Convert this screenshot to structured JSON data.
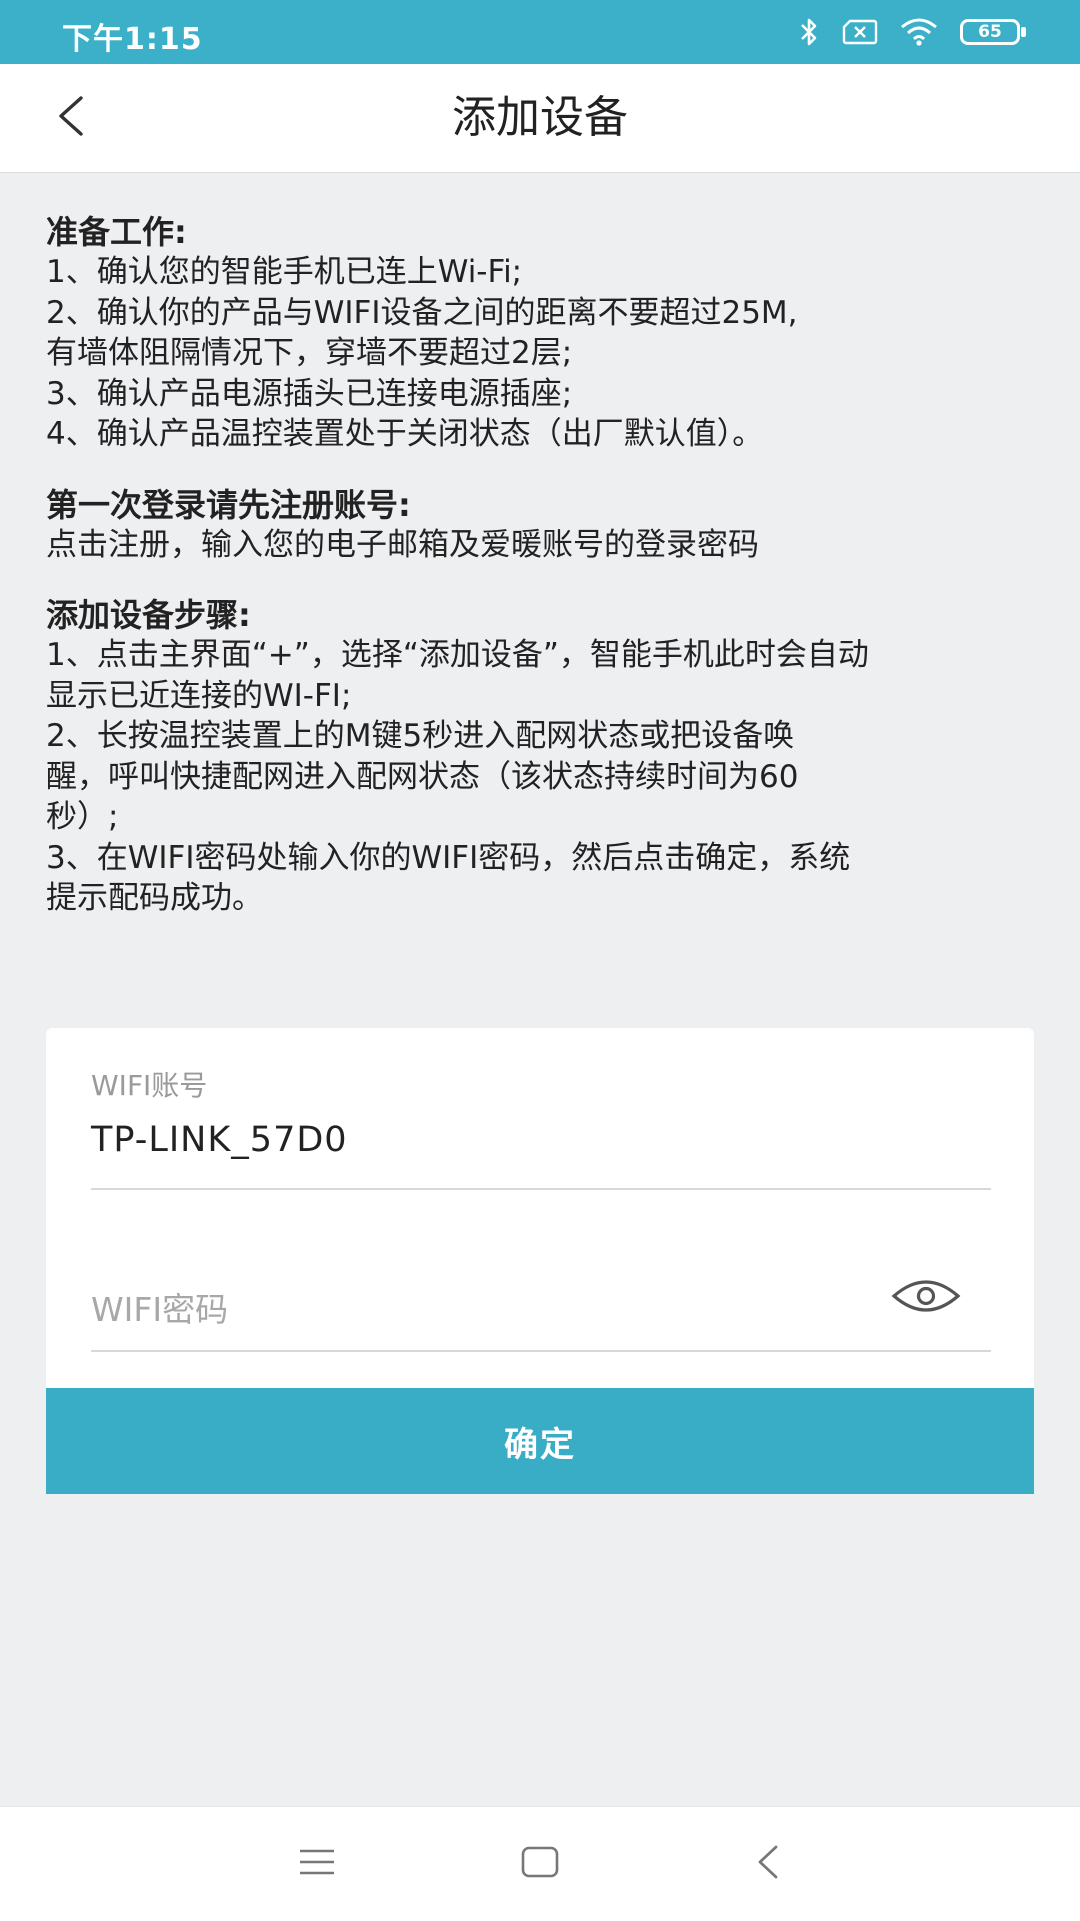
{
  "status_bar": {
    "time": "下午1:15",
    "battery": "65",
    "icons": [
      "bluetooth-icon",
      "no-sim-icon",
      "wifi-signal-icon",
      "battery-icon"
    ]
  },
  "header": {
    "title": "添加设备",
    "back_icon": "chevron-left-icon"
  },
  "instructions": {
    "prep_title": "准备工作:",
    "prep_lines": [
      "1、确认您的智能手机已连上Wi-Fi;",
      " 2、确认你的产品与WIFI设备之间的距离不要超过25M,",
      "有墙体阻隔情况下，穿墙不要超过2层;",
      " 3、确认产品电源插头已连接电源插座;",
      " 4、确认产品温控装置处于关闭状态（出厂默认值）。"
    ],
    "register_title": "第一次登录请先注册账号:",
    "register_lines": [
      "点击注册，输入您的电子邮箱及爱暖账号的登录密码"
    ],
    "steps_title": "添加设备步骤:",
    "steps_lines": [
      "1、点击主界面“+”，选择“添加设备”，智能手机此时会自动",
      "显示已近连接的WI-FI;",
      " 2、长按温控装置上的M键5秒进入配网状态或把设备唤",
      "醒，呼叫快捷配网进入配网状态（该状态持续时间为60",
      "秒）;",
      " 3、在WIFI密码处输入你的WIFI密码，然后点击确定，系统",
      "提示配码成功。"
    ]
  },
  "form": {
    "wifi_account_label": "WIFI账号",
    "wifi_account_value": "TP-LINK_57D0",
    "wifi_password_placeholder": "WIFI密码",
    "eye_icon": "eye-icon",
    "confirm_label": "确定"
  },
  "nav_bar": {
    "icons": [
      "menu-icon",
      "home-square-icon",
      "back-triangle-icon"
    ]
  },
  "colors": {
    "accent": "#3aadc6",
    "status_bar": "#3cb0c8",
    "background": "#eeeff1"
  }
}
